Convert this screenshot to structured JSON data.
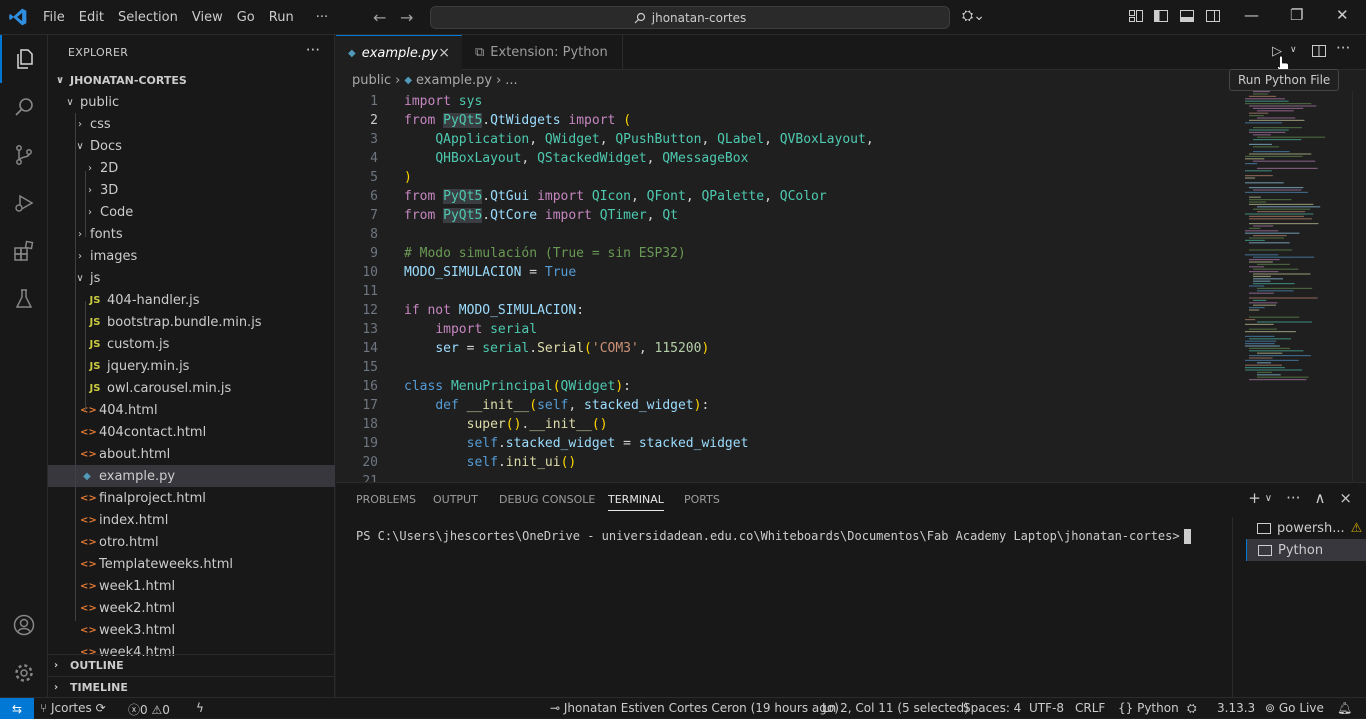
{
  "menu": [
    "File",
    "Edit",
    "Selection",
    "View",
    "Go",
    "Run",
    "···"
  ],
  "search": {
    "text": "jhonatan-cortes"
  },
  "explorer": {
    "title": "EXPLORER",
    "more": "···",
    "root": "JHONATAN-CORTES",
    "tree": [
      {
        "label": "public",
        "chev": "∨",
        "icon": ""
      },
      {
        "label": "css",
        "chev": "›",
        "icon": ""
      },
      {
        "label": "Docs",
        "chev": "∨",
        "icon": ""
      },
      {
        "label": "2D",
        "chev": "›",
        "icon": ""
      },
      {
        "label": "3D",
        "chev": "›",
        "icon": ""
      },
      {
        "label": "Code",
        "chev": "›",
        "icon": ""
      },
      {
        "label": "fonts",
        "chev": "›",
        "icon": ""
      },
      {
        "label": "images",
        "chev": "›",
        "icon": ""
      },
      {
        "label": "js",
        "chev": "∨",
        "icon": ""
      },
      {
        "label": "404-handler.js",
        "chev": "",
        "icon": "JS"
      },
      {
        "label": "bootstrap.bundle.min.js",
        "chev": "",
        "icon": "JS"
      },
      {
        "label": "custom.js",
        "chev": "",
        "icon": "JS"
      },
      {
        "label": "jquery.min.js",
        "chev": "",
        "icon": "JS"
      },
      {
        "label": "owl.carousel.min.js",
        "chev": "",
        "icon": "JS"
      },
      {
        "label": "404.html",
        "chev": "",
        "icon": "<>"
      },
      {
        "label": "404contact.html",
        "chev": "",
        "icon": "<>"
      },
      {
        "label": "about.html",
        "chev": "",
        "icon": "<>"
      },
      {
        "label": "example.py",
        "chev": "",
        "icon": "◆"
      },
      {
        "label": "finalproject.html",
        "chev": "",
        "icon": "<>"
      },
      {
        "label": "index.html",
        "chev": "",
        "icon": "<>"
      },
      {
        "label": "otro.html",
        "chev": "",
        "icon": "<>"
      },
      {
        "label": "Templateweeks.html",
        "chev": "",
        "icon": "<>"
      },
      {
        "label": "week1.html",
        "chev": "",
        "icon": "<>"
      },
      {
        "label": "week2.html",
        "chev": "",
        "icon": "<>"
      },
      {
        "label": "week3.html",
        "chev": "",
        "icon": "<>"
      },
      {
        "label": "week4.html",
        "chev": "",
        "icon": "<>"
      }
    ],
    "outline": "OUTLINE",
    "timeline": "TIMELINE"
  },
  "tabs": {
    "active": {
      "label": "example.py",
      "close": "×"
    },
    "other": {
      "label": "Extension: Python"
    }
  },
  "tooltip": "Run Python File",
  "breadcrumb": {
    "folder": "public",
    "file": "example.py",
    "more": "..."
  },
  "code": {
    "current_line": 2,
    "lines": [
      "import sys",
      "from PyQt5.QtWidgets import (",
      "    QApplication, QWidget, QPushButton, QLabel, QVBoxLayout,",
      "    QHBoxLayout, QStackedWidget, QMessageBox",
      ")",
      "from PyQt5.QtGui import QIcon, QFont, QPalette, QColor",
      "from PyQt5.QtCore import QTimer, Qt",
      "",
      "# Modo simulación (True = sin ESP32)",
      "MODO_SIMULACION = True",
      "",
      "if not MODO_SIMULACION:",
      "    import serial",
      "    ser = serial.Serial('COM3', 115200)",
      "",
      "class MenuPrincipal(QWidget):",
      "    def __init__(self, stacked_widget):",
      "        super().__init__()",
      "        self.stacked_widget = stacked_widget",
      "        self.init_ui()"
    ],
    "line_numbers": [
      "1",
      "2",
      "3",
      "4",
      "5",
      "6",
      "7",
      "8",
      "9",
      "10",
      "11",
      "12",
      "13",
      "14",
      "15",
      "16",
      "17",
      "18",
      "19",
      "20",
      "21"
    ]
  },
  "panel": {
    "tabs": [
      "PROBLEMS",
      "OUTPUT",
      "DEBUG CONSOLE",
      "TERMINAL",
      "PORTS"
    ],
    "active_tab": "TERMINAL",
    "actions": [
      "+",
      "∨",
      "···",
      "∧",
      "×"
    ],
    "terminal_text": "PS C:\\Users\\jhescortes\\OneDrive - universidadean.edu.co\\Whiteboards\\Documentos\\Fab Academy Laptop\\jhonatan-cortes>",
    "terminals": [
      {
        "label": "powersh..."
      },
      {
        "label": "Python"
      }
    ]
  },
  "status": {
    "branch": "Jcortes",
    "errors": "0",
    "warnings": "0",
    "blame": "Jhonatan Estiven Cortes Ceron (19 hours ago)",
    "position": "Ln 2, Col 11 (5 selected)",
    "spaces": "Spaces: 4",
    "encoding": "UTF-8",
    "eol": "CRLF",
    "language": "Python",
    "python_version": "3.13.3",
    "go_live": "Go Live"
  },
  "colors": {
    "accent": "#0078d4",
    "background": "#1f1f1f",
    "sidebar": "#181818"
  }
}
